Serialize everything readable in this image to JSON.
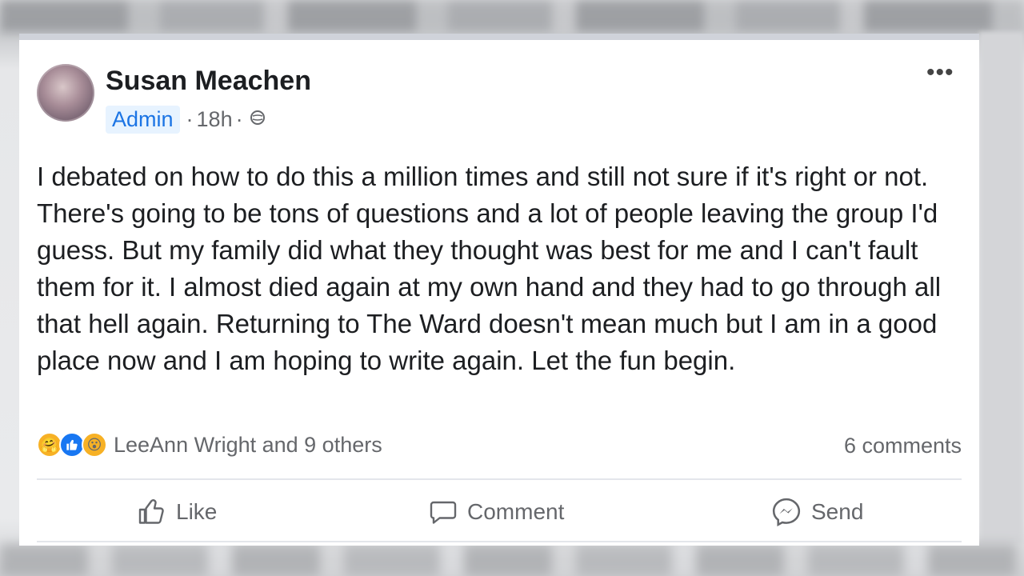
{
  "post": {
    "author": "Susan Meachen",
    "role_badge": "Admin",
    "time": "18h",
    "separator": "·",
    "more_label": "•••",
    "text": "I debated on how to do this a million times and still not sure if it's right or not. There's going to be tons of questions and a lot of people leaving the group I'd guess. But my family did what they thought was best for me and I can't fault them for it. I almost died again at my own hand and they had to go through all that hell again. Returning to The Ward doesn't mean much but I am in a good place now and I am hoping to write again. Let the fun begin.",
    "reactions_summary": "LeeAnn Wright and 9 others",
    "comments_count": "6 comments",
    "reaction_icons": [
      "care-reaction",
      "like-reaction",
      "wow-reaction"
    ]
  },
  "actions": {
    "like_label": "Like",
    "comment_label": "Comment",
    "send_label": "Send"
  },
  "colors": {
    "accent": "#1b74e4",
    "muted_text": "#65676b",
    "text": "#1c1e21"
  }
}
